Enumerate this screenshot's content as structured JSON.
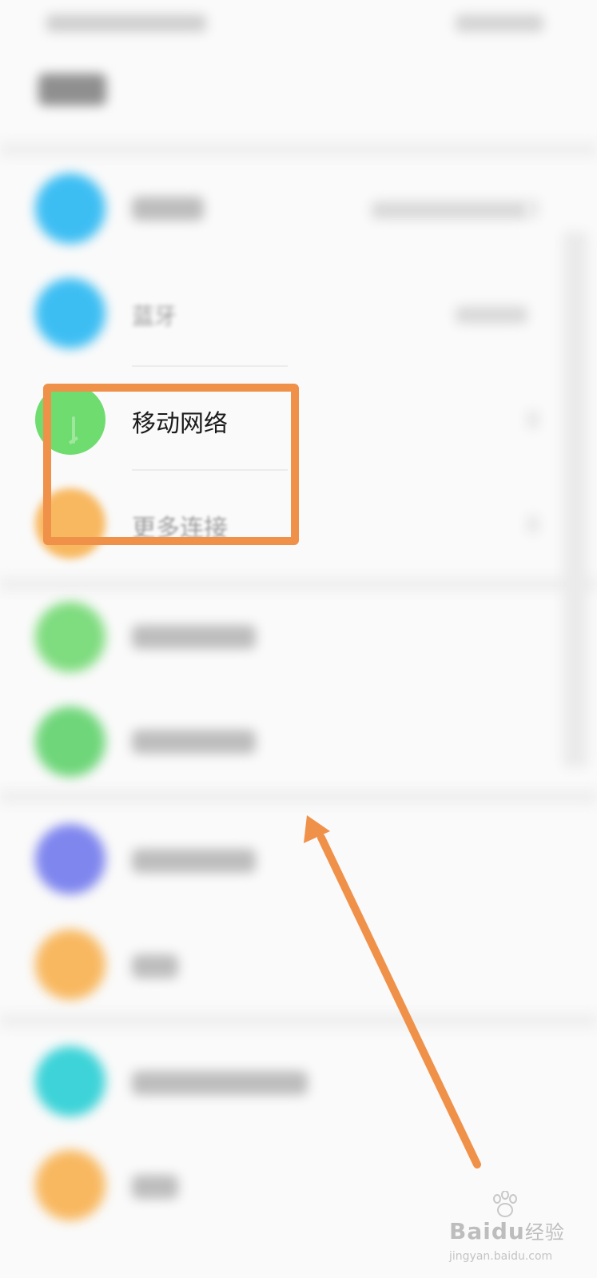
{
  "colors": {
    "accent_annotation": "#f0914a",
    "icon_blue": "#3dbef3",
    "icon_green": "#6fdc6f",
    "icon_orange": "#f8b860",
    "icon_indigo": "#7f86ee",
    "icon_teal": "#3dd3d8"
  },
  "settings_list": {
    "bluetooth_label": "蓝牙",
    "mobile_network_label": "移动网络",
    "more_connections_label": "更多连接"
  },
  "icons": {
    "wifi": "wifi-icon",
    "bluetooth": "bluetooth-icon",
    "mobile_network": "mobile-network-icon",
    "more_connections": "more-connections-icon"
  },
  "watermark": {
    "brand": "Baidu",
    "brand_cn": "经验",
    "url": "jingyan.baidu.com"
  }
}
